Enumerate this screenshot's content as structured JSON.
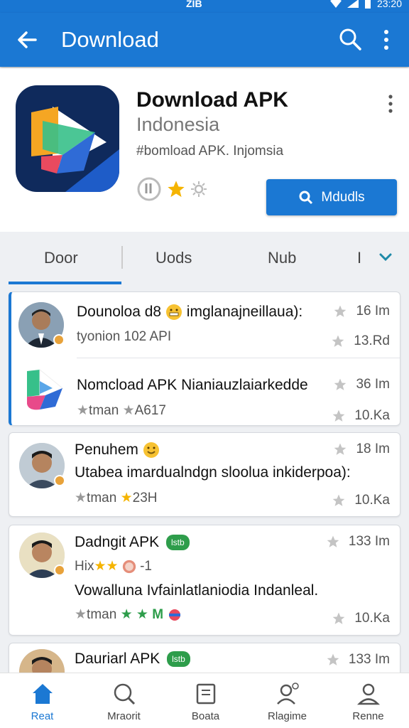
{
  "status_bar": {
    "center": "ZIB",
    "time": "23:20"
  },
  "app_bar": {
    "title": "Download"
  },
  "app": {
    "name": "Download APK",
    "subtitle": "Indonesia",
    "tag": "#bomload APK. Injomsia",
    "install_label": "Mdudls"
  },
  "tabs": [
    {
      "label": "Door"
    },
    {
      "label": "Uods"
    },
    {
      "label": "Nub"
    },
    {
      "label": "I"
    }
  ],
  "cards": [
    {
      "rows": [
        {
          "title": "Dounoloa d8",
          "title_suffix": " imglanajneillaua):",
          "sub": "tyonion 102 API",
          "meta_top": "16 Im",
          "meta_bottom": "13.Rd"
        },
        {
          "title": "Nomcload APK Nianiauzlaiarkedde",
          "sub_prefix": "tman",
          "sub": "A617",
          "meta_top": "36 Im",
          "meta_bottom": "10.Ka"
        }
      ]
    },
    {
      "rows": [
        {
          "title": "Penuhem",
          "desc": "Utabea imardualndgn sloolua inkiderpoa):",
          "sub_prefix": "tman",
          "sub": "23H",
          "meta_top": "18 Im",
          "meta_bottom": "10.Ka"
        }
      ]
    },
    {
      "rows": [
        {
          "title": "Dadngit APK",
          "pill": "lstb",
          "sub_prefix": "Hix",
          "sub_suffix": "-1",
          "desc": "Vowalluna Ivfainlatlaniodia Indanleal.",
          "sub2_prefix": "tman",
          "sub2": "M",
          "meta_top": "133 Im",
          "meta_bottom": "10.Ka"
        }
      ]
    },
    {
      "rows": [
        {
          "title": "Dauriarl APK",
          "pill": "lstb",
          "meta_top": "133 Im"
        }
      ]
    }
  ],
  "bottom_nav": [
    {
      "label": "Reat",
      "icon": "home-icon",
      "active": true
    },
    {
      "label": "Mraorit",
      "icon": "search-icon"
    },
    {
      "label": "Boata",
      "icon": "book-icon"
    },
    {
      "label": "Rlagime",
      "icon": "people-icon"
    },
    {
      "label": "Renne",
      "icon": "person-icon"
    }
  ],
  "colors": {
    "primary": "#1b78d3",
    "background": "#eef0f3",
    "star": "#f5b400",
    "pill": "#2e9d4b"
  }
}
